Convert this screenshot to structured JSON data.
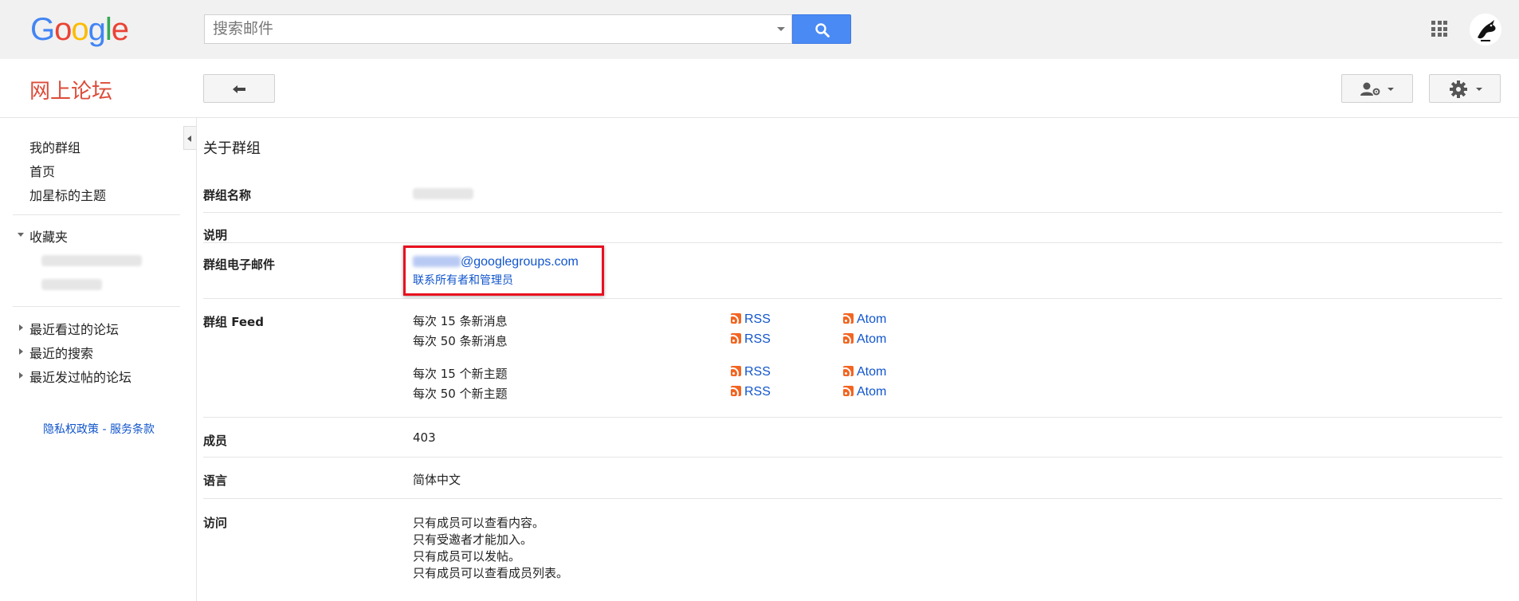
{
  "header": {
    "logo_letters": [
      {
        "ch": "G",
        "color": "#4285F4"
      },
      {
        "ch": "o",
        "color": "#EA4335"
      },
      {
        "ch": "o",
        "color": "#FBBC05"
      },
      {
        "ch": "g",
        "color": "#4285F4"
      },
      {
        "ch": "l",
        "color": "#34A853"
      },
      {
        "ch": "e",
        "color": "#EA4335"
      }
    ],
    "search_placeholder": "搜索邮件"
  },
  "subheader": {
    "title": "网上论坛",
    "title_color": "#dd4b39"
  },
  "sidebar": {
    "items": [
      {
        "label": "我的群组"
      },
      {
        "label": "首页"
      },
      {
        "label": "加星标的主题"
      }
    ],
    "favorites_label": "收藏夹",
    "collapsible": [
      {
        "label": "最近看过的论坛"
      },
      {
        "label": "最近的搜索"
      },
      {
        "label": "最近发过帖的论坛"
      }
    ],
    "privacy_link": "隐私权政策",
    "separator": "-",
    "terms_link": "服务条款"
  },
  "main": {
    "section_title": "关于群组",
    "rows": {
      "name_label": "群组名称",
      "description_label": "说明",
      "email_label": "群组电子邮件",
      "email_domain": "@googlegroups.com",
      "contact_link": "联系所有者和管理员",
      "feed_label": "群组 Feed",
      "members_label": "成员",
      "members_value": "403",
      "language_label": "语言",
      "language_value": "简体中文",
      "access_label": "访问",
      "access_lines": [
        "只有成员可以查看内容。",
        "只有受邀者才能加入。",
        "只有成员可以发帖。",
        "只有成员可以查看成员列表。"
      ]
    },
    "feeds": [
      {
        "label": "每次 15 条新消息",
        "rss": "RSS",
        "atom": "Atom"
      },
      {
        "label": "每次 50 条新消息",
        "rss": "RSS",
        "atom": "Atom"
      },
      {
        "label": "每次 15 个新主题",
        "rss": "RSS",
        "atom": "Atom"
      },
      {
        "label": "每次 50 个新主题",
        "rss": "RSS",
        "atom": "Atom"
      }
    ]
  },
  "colors": {
    "accent_blue": "#4a8af4",
    "link": "#1155cc",
    "highlight": "#e8101f"
  }
}
